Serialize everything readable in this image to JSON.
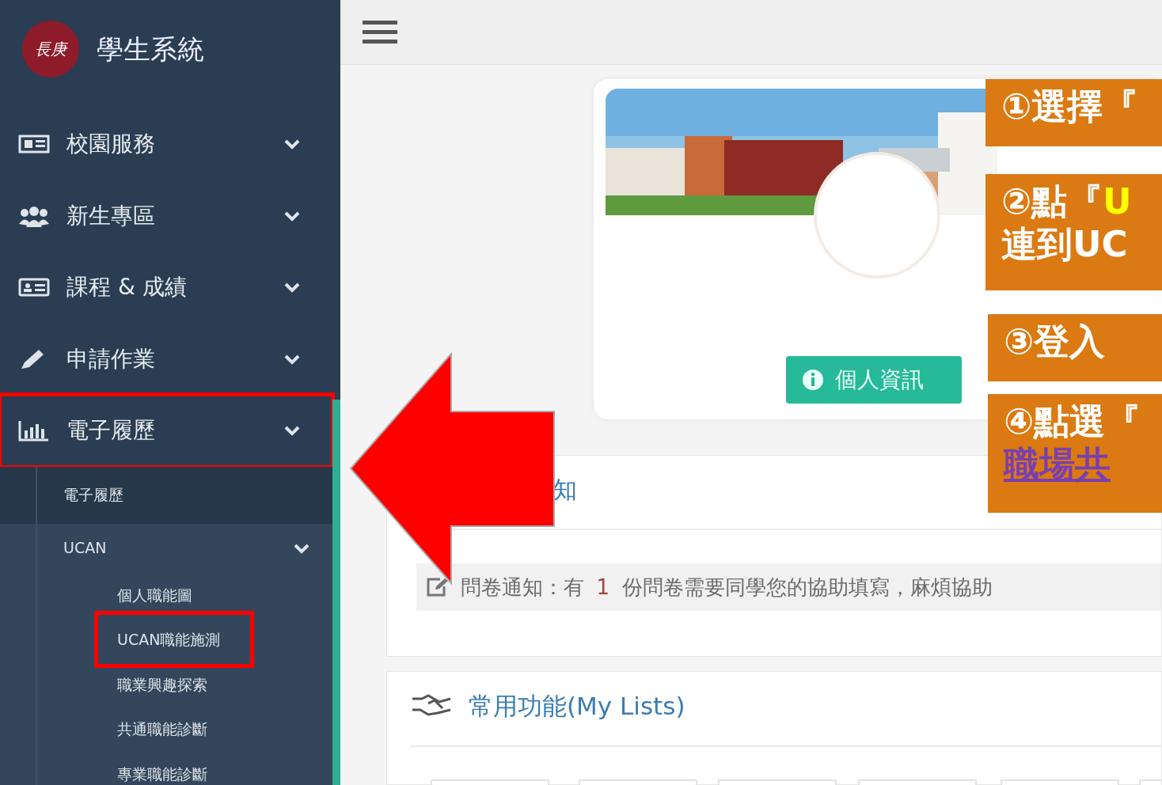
{
  "sidebar": {
    "brand_logo": "長庚",
    "title": "學生系統",
    "items": [
      {
        "kind": "card",
        "label": "校園服務",
        "highlighted": false
      },
      {
        "kind": "users",
        "label": "新生專區",
        "highlighted": false
      },
      {
        "kind": "idcard",
        "label": "課程 & 成績",
        "highlighted": false
      },
      {
        "kind": "pencil",
        "label": "申請作業",
        "highlighted": false
      },
      {
        "kind": "chart",
        "label": "電子履歷",
        "highlighted": true,
        "children": [
          {
            "label": "電子履歷",
            "highlighted": false
          },
          {
            "label": "UCAN",
            "highlighted": false,
            "children": [
              {
                "label": "個人職能圖",
                "highlighted": false
              },
              {
                "label": "UCAN職能施測",
                "highlighted": true
              },
              {
                "label": "職業興趣探索",
                "highlighted": false
              },
              {
                "label": "共通職能診斷",
                "highlighted": false
              },
              {
                "label": "專業職能診斷",
                "highlighted": false
              }
            ]
          }
        ]
      }
    ]
  },
  "profile": {
    "button": "個人資訊"
  },
  "notice_card": {
    "title": "知",
    "notice_prefix": "問卷通知：有",
    "notice_count": "1",
    "notice_suffix": "份問卷需要同學您的協助填寫，麻煩協助"
  },
  "lists_card": {
    "title": "常用功能(My Lists)"
  },
  "callouts": [
    {
      "lines": [
        {
          "text": "①選擇『",
          "underline": false
        }
      ]
    },
    {
      "lines": [
        {
          "text": "②點『**U**",
          "underline": false
        },
        {
          "text": "連到UC",
          "underline": false
        }
      ]
    },
    {
      "lines": [
        {
          "text": "③登入",
          "underline": false
        }
      ]
    },
    {
      "lines": [
        {
          "text": "④點選『",
          "underline": false
        },
        {
          "text": "職場共",
          "underline": true
        }
      ]
    }
  ]
}
